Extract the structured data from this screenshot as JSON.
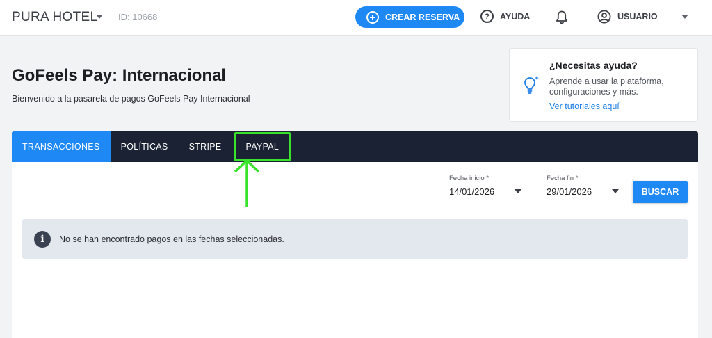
{
  "topbar": {
    "hotel_name": "PURA HOTEL",
    "hotel_id": "ID: 10668",
    "crear_reserva_label": "CREAR RESERVA",
    "ayuda_label": "AYUDA",
    "usuario_label": "USUARIO",
    "icons": [
      "chevron-down-icon",
      "plus-circle-icon",
      "help-circle-icon",
      "bell-icon",
      "user-circle-icon"
    ]
  },
  "heading": {
    "title": "GoFeels Pay: Internacional",
    "subtitle": "Bienvenido a la pasarela de pagos GoFeels Pay Internacional"
  },
  "help_card": {
    "title": "¿Necesitas ayuda?",
    "text": "Aprende a usar la plataforma, configuraciones y más.",
    "link": "Ver tutoriales aquí",
    "icon": "lightbulb-icon"
  },
  "tabs": [
    {
      "label": "TRANSACCIONES",
      "active": true
    },
    {
      "label": "POLÍTICAS",
      "active": false
    },
    {
      "label": "STRIPE",
      "active": false
    },
    {
      "label": "PAYPAL",
      "active": false,
      "highlighted": true
    }
  ],
  "filters": {
    "fecha_inicio": {
      "label": "Fecha inicio *",
      "value": "14/01/2026"
    },
    "fecha_fin": {
      "label": "Fecha fin *",
      "value": "29/01/2026"
    },
    "buscar_label": "BUSCAR"
  },
  "alert": {
    "text": "No se han encontrado pagos en las fechas seleccionadas.",
    "icon": "info-icon"
  },
  "colors": {
    "accent": "#1e88f5",
    "tabs_bg": "#1b2233",
    "highlight": "#39e22b",
    "alert_bg": "#e3e8ef"
  }
}
